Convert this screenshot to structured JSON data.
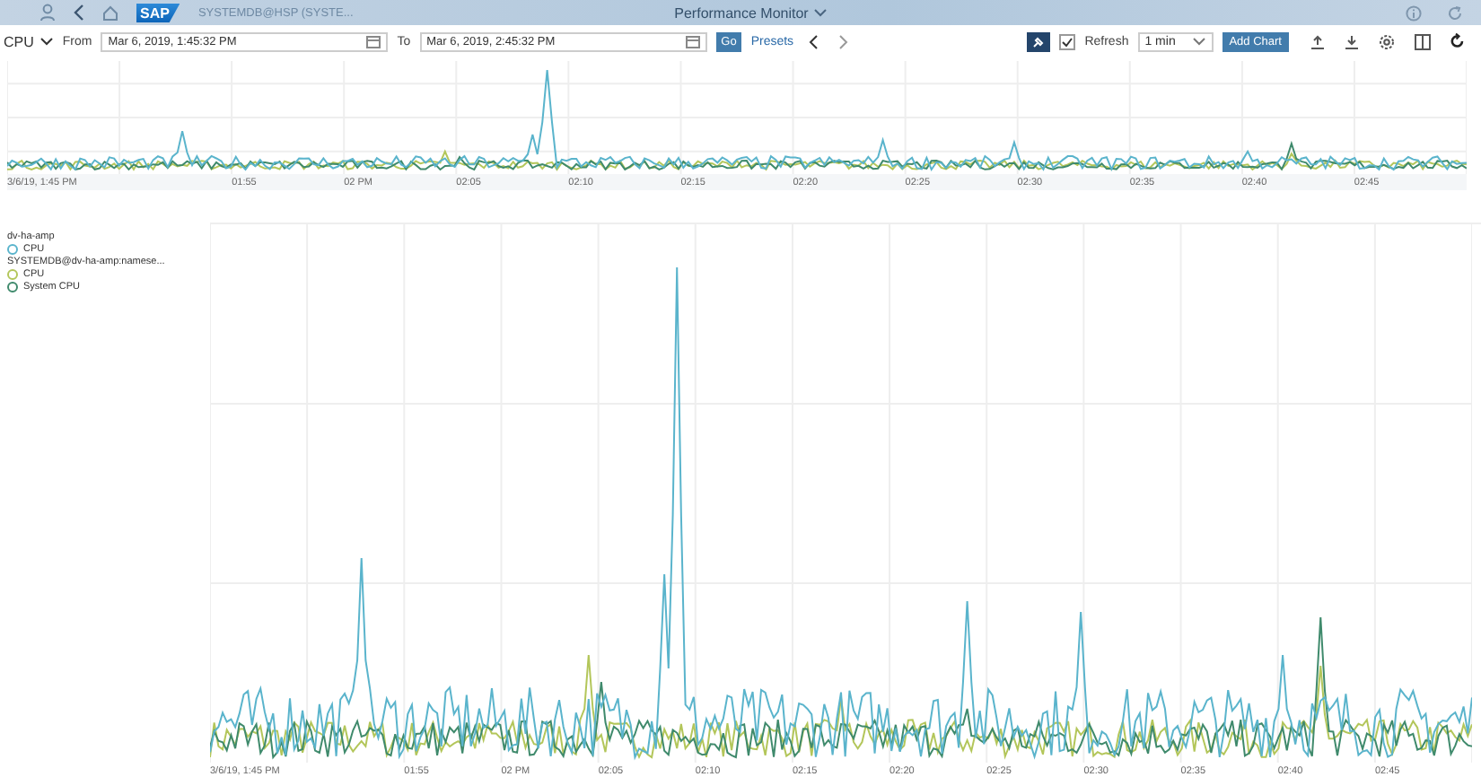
{
  "header": {
    "system": "SYSTEMDB@HSP (SYSTE...",
    "logo": "SAP",
    "title": "Performance Monitor"
  },
  "toolbar": {
    "metric": "CPU",
    "from_label": "From",
    "from": "Mar 6, 2019, 1:45:32 PM",
    "to_label": "To",
    "to": "Mar 6, 2019, 2:45:32 PM",
    "go": "Go",
    "presets": "Presets",
    "refresh": {
      "label": "Refresh",
      "checked": true
    },
    "interval": "1 min",
    "add_chart": "Add Chart"
  },
  "overview": {
    "x_labels": [
      "3/6/19, 1:45 PM",
      "01:55",
      "02 PM",
      "02:05",
      "02:10",
      "02:15",
      "02:20",
      "02:25",
      "02:30",
      "02:35",
      "02:40",
      "02:45"
    ]
  },
  "chart": {
    "x_labels": [
      "3/6/19, 1:45 PM",
      "01:55",
      "02 PM",
      "02:05",
      "02:10",
      "02:15",
      "02:20",
      "02:25",
      "02:30",
      "02:35",
      "02:40",
      "02:45"
    ]
  },
  "legend": [
    {
      "name": "dv-ha-amp",
      "items": [
        {
          "label": "CPU",
          "color": "#5ab4cc"
        }
      ]
    },
    {
      "name": "SYSTEMDB@dv-ha-amp:namese...",
      "items": [
        {
          "label": "CPU",
          "color": "#b3c65a"
        },
        {
          "label": "System CPU",
          "color": "#3f8a6c"
        }
      ]
    }
  ]
}
